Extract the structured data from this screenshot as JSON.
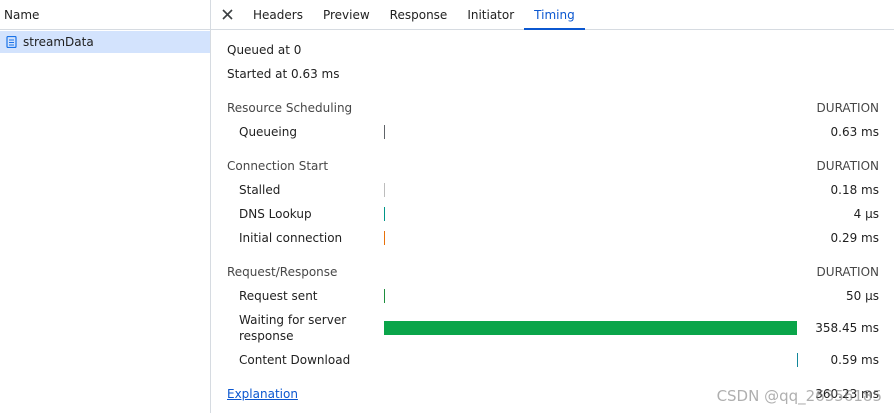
{
  "left": {
    "header": "Name",
    "rows": [
      {
        "name": "streamData"
      }
    ]
  },
  "tabs": [
    {
      "label": "Headers",
      "active": false
    },
    {
      "label": "Preview",
      "active": false
    },
    {
      "label": "Response",
      "active": false
    },
    {
      "label": "Initiator",
      "active": false
    },
    {
      "label": "Timing",
      "active": true
    }
  ],
  "timing": {
    "queued_at": "Queued at 0",
    "started_at": "Started at 0.63 ms",
    "sections": [
      {
        "title": "Resource Scheduling",
        "duration_header": "DURATION",
        "rows": [
          {
            "label": "Queueing",
            "value": "0.63 ms",
            "color": "#5f6368",
            "start": 0.0,
            "span": 0.002
          }
        ]
      },
      {
        "title": "Connection Start",
        "duration_header": "DURATION",
        "rows": [
          {
            "label": "Stalled",
            "value": "0.18 ms",
            "color": "#bdbdbd",
            "start": 0.0,
            "span": 0.0006
          },
          {
            "label": "DNS Lookup",
            "value": "4 µs",
            "color": "#009688",
            "start": 0.0,
            "span": 0.0002
          },
          {
            "label": "Initial connection",
            "value": "0.29 ms",
            "color": "#e8710a",
            "start": 0.0,
            "span": 0.0008
          }
        ]
      },
      {
        "title": "Request/Response",
        "duration_header": "DURATION",
        "rows": [
          {
            "label": "Request sent",
            "value": "50 µs",
            "color": "#1e8e3e",
            "start": 0.0,
            "span": 0.0002
          },
          {
            "label": "Waiting for server response",
            "value": "358.45 ms",
            "color": "#0aa54a",
            "start": 0.0,
            "span": 0.9968
          },
          {
            "label": "Content Download",
            "value": "0.59 ms",
            "color": "#12879a",
            "start": 0.9968,
            "span": 0.0016
          }
        ]
      }
    ],
    "explanation_link": "Explanation",
    "total": "360.23 ms"
  },
  "watermark": "CSDN @qq_26356185",
  "icons": {
    "close": "close-icon",
    "document": "document-icon"
  }
}
